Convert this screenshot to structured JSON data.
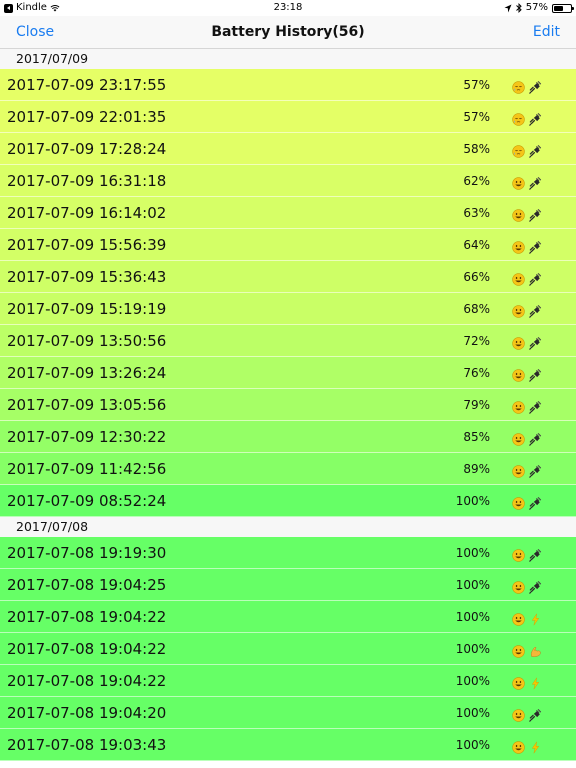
{
  "status_bar": {
    "carrier": "Kindle",
    "time": "23:18",
    "battery_text": "57%",
    "battery_level": 0.57
  },
  "nav": {
    "left_label": "Close",
    "title": "Battery History(56)",
    "right_label": "Edit",
    "accent": "#1a7cf0"
  },
  "sections": [
    {
      "header": "2017/07/09",
      "rows": [
        {
          "time": "2017-07-09 23:17:55",
          "percent": "57%",
          "mood_icon": "sleepy-face-icon",
          "state_icon": "plug-icon",
          "color": "#e6ff66"
        },
        {
          "time": "2017-07-09 22:01:35",
          "percent": "57%",
          "mood_icon": "sleepy-face-icon",
          "state_icon": "plug-icon",
          "color": "#e4ff66"
        },
        {
          "time": "2017-07-09 17:28:24",
          "percent": "58%",
          "mood_icon": "sleepy-face-icon",
          "state_icon": "plug-icon",
          "color": "#e1ff66"
        },
        {
          "time": "2017-07-09 16:31:18",
          "percent": "62%",
          "mood_icon": "smiley-face-icon",
          "state_icon": "plug-icon",
          "color": "#d9ff66"
        },
        {
          "time": "2017-07-09 16:14:02",
          "percent": "63%",
          "mood_icon": "smiley-face-icon",
          "state_icon": "plug-icon",
          "color": "#d6ff66"
        },
        {
          "time": "2017-07-09 15:56:39",
          "percent": "64%",
          "mood_icon": "smiley-face-icon",
          "state_icon": "plug-icon",
          "color": "#d3ff66"
        },
        {
          "time": "2017-07-09 15:36:43",
          "percent": "66%",
          "mood_icon": "smiley-face-icon",
          "state_icon": "plug-icon",
          "color": "#ceff66"
        },
        {
          "time": "2017-07-09 15:19:19",
          "percent": "68%",
          "mood_icon": "smiley-face-icon",
          "state_icon": "plug-icon",
          "color": "#c9ff66"
        },
        {
          "time": "2017-07-09 13:50:56",
          "percent": "72%",
          "mood_icon": "smiley-face-icon",
          "state_icon": "plug-icon",
          "color": "#bcff66"
        },
        {
          "time": "2017-07-09 13:26:24",
          "percent": "76%",
          "mood_icon": "smiley-face-icon",
          "state_icon": "plug-icon",
          "color": "#b0ff66"
        },
        {
          "time": "2017-07-09 13:05:56",
          "percent": "79%",
          "mood_icon": "smiley-face-icon",
          "state_icon": "plug-icon",
          "color": "#a6ff66"
        },
        {
          "time": "2017-07-09 12:30:22",
          "percent": "85%",
          "mood_icon": "smiley-face-icon",
          "state_icon": "plug-icon",
          "color": "#94ff66"
        },
        {
          "time": "2017-07-09 11:42:56",
          "percent": "89%",
          "mood_icon": "smiley-face-icon",
          "state_icon": "plug-icon",
          "color": "#86ff66"
        },
        {
          "time": "2017-07-09 08:52:24",
          "percent": "100%",
          "mood_icon": "smiley-face-icon",
          "state_icon": "plug-icon",
          "color": "#66ff66"
        }
      ]
    },
    {
      "header": "2017/07/08",
      "rows": [
        {
          "time": "2017-07-08 19:19:30",
          "percent": "100%",
          "mood_icon": "smiley-face-icon",
          "state_icon": "plug-icon",
          "color": "#66ff66"
        },
        {
          "time": "2017-07-08 19:04:25",
          "percent": "100%",
          "mood_icon": "smiley-face-icon",
          "state_icon": "plug-icon",
          "color": "#66ff66"
        },
        {
          "time": "2017-07-08 19:04:22",
          "percent": "100%",
          "mood_icon": "smiley-face-icon",
          "state_icon": "lightning-icon",
          "color": "#66ff66"
        },
        {
          "time": "2017-07-08 19:04:22",
          "percent": "100%",
          "mood_icon": "smiley-face-icon",
          "state_icon": "flexed-bicep-icon",
          "color": "#66ff66"
        },
        {
          "time": "2017-07-08 19:04:22",
          "percent": "100%",
          "mood_icon": "smiley-face-icon",
          "state_icon": "lightning-icon",
          "color": "#66ff66"
        },
        {
          "time": "2017-07-08 19:04:20",
          "percent": "100%",
          "mood_icon": "smiley-face-icon",
          "state_icon": "plug-icon",
          "color": "#66ff66"
        },
        {
          "time": "2017-07-08 19:03:43",
          "percent": "100%",
          "mood_icon": "smiley-face-icon",
          "state_icon": "lightning-icon",
          "color": "#66ff66"
        }
      ]
    }
  ]
}
